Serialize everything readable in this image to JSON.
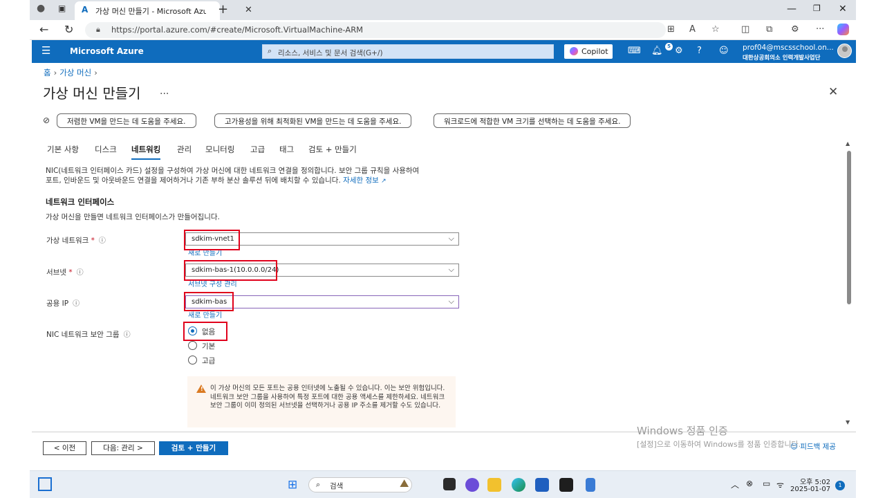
{
  "browser": {
    "tab_title": "가상 머신 만들기 - Microsoft Azure",
    "url": "https://portal.azure.com/#create/Microsoft.VirtualMachine-ARM"
  },
  "azure_header": {
    "brand": "Microsoft Azure",
    "search_placeholder": "리소스, 서비스 및 문서 검색(G+/)",
    "copilot_label": "Copilot",
    "notification_count": "5",
    "account_email": "prof04@mscsschool.on...",
    "account_org": "대한상공회의소 인력개발사업단"
  },
  "breadcrumb": {
    "home": "홈",
    "vm": "가상 머신"
  },
  "page": {
    "title": "가상 머신 만들기",
    "more": "..."
  },
  "helper_chips": [
    "저렴한 VM을 만드는 데 도움을 주세요.",
    "고가용성을 위해 최적화된 VM을 만드는 데 도움을 주세요.",
    "워크로드에 적합한 VM 크기를 선택하는 데 도움을 주세요."
  ],
  "tabs": [
    "기본 사항",
    "디스크",
    "네트워킹",
    "관리",
    "모니터링",
    "고급",
    "태그",
    "검토 + 만들기"
  ],
  "description": {
    "line1": "NIC(네트워크 인터페이스 카드) 설정을 구성하여 가상 머신에 대한 네트워크 연결을 정의합니다. 보안 그룹 규칙을 사용하여",
    "line2": "포트, 인바운드 및 아웃바운드 연결을 제어하거나 기존 부하 분산 솔루션 뒤에 배치할 수 있습니다.",
    "more_link": "자세한 정보"
  },
  "network_interface": {
    "title": "네트워크 인터페이스",
    "subtitle": "가상 머신을 만들면 네트워크 인터페이스가 만들어집니다.",
    "vnet_label": "가상 네트워크",
    "vnet_value": "sdkim-vnet1",
    "vnet_link": "새로 만들기",
    "subnet_label": "서브넷",
    "subnet_value": "sdkim-bas-1(10.0.0.0/24)",
    "subnet_link": "서브넷 구성 관리",
    "pip_label": "공용 IP",
    "pip_value": "sdkim-bas",
    "pip_link": "새로 만들기",
    "nsg_label": "NIC 네트워크 보안 그룹",
    "nsg_options": [
      "없음",
      "기본",
      "고급"
    ],
    "required_mark": "*"
  },
  "warning": {
    "text": "이 가상 머신의 모든 포트는 공용 인터넷에 노출될 수 있습니다. 이는 보안 위험입니다. 네트워크 보안 그룹을 사용하여 특정 포트에 대한 공용 액세스를 제한하세요. 네트워크 보안 그룹이 이미 정의된 서브넷을 선택하거나 공용 IP 주소를 제거할 수도 있습니다."
  },
  "footer": {
    "prev": "< 이전",
    "next": "다음: 관리 >",
    "review": "검토 + 만들기",
    "feedback": "피드백 제공"
  },
  "watermark": {
    "line1": "Windows 정품 인증",
    "line2": "[설정]으로 이동하여 Windows를 정품 인증합니다."
  },
  "taskbar": {
    "search": "검색",
    "time": "오후 5:02",
    "date": "2025-01-07",
    "notif": "1"
  },
  "colors": {
    "azure_blue": "#0f6cbd",
    "highlight_red": "#e0001b",
    "warning_orange": "#da7a22"
  }
}
